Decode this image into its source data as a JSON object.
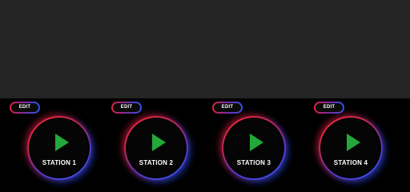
{
  "stations": [
    {
      "edit_label": "EDIT",
      "name": "STATION 1"
    },
    {
      "edit_label": "EDIT",
      "name": "STATION 2"
    },
    {
      "edit_label": "EDIT",
      "name": "STATION 3"
    },
    {
      "edit_label": "EDIT",
      "name": "STATION 4"
    }
  ],
  "colors": {
    "top_background": "#242424",
    "bottom_background": "#000000",
    "ring_red": "#ff2a3c",
    "ring_blue": "#2a5cff",
    "play_green": "#23a83a"
  },
  "icons": {
    "play": "play-icon"
  }
}
